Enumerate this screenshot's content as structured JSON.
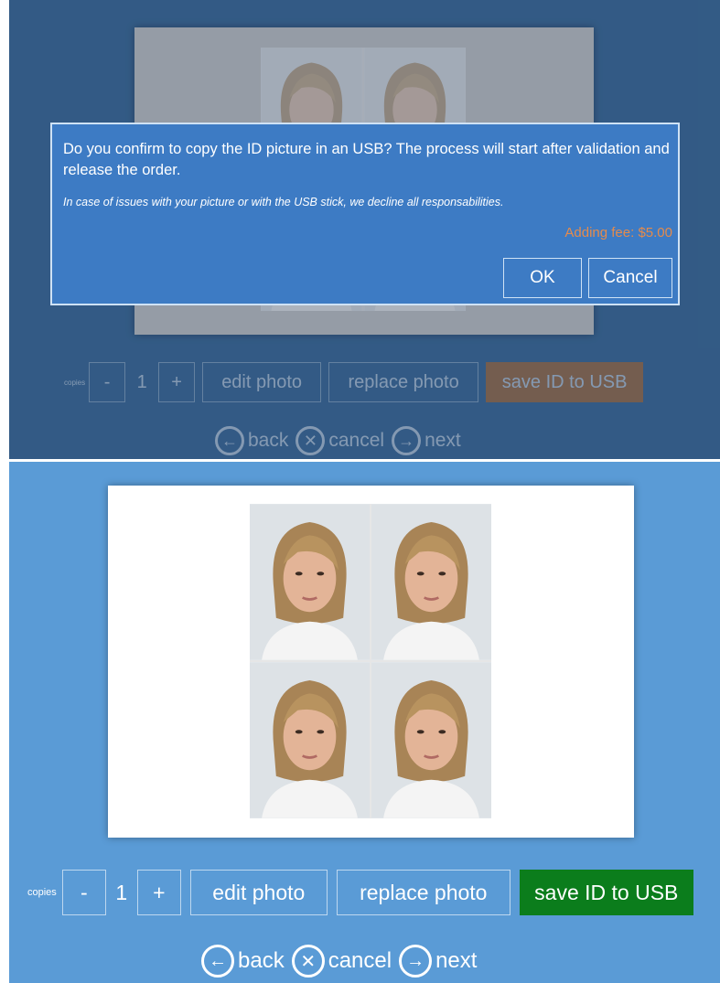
{
  "dialog": {
    "message": "Do you confirm to copy the ID picture in an USB? The process will start after validation and release the order.",
    "warning": "In case of issues with your picture or with the USB stick, we decline all responsabilities.",
    "fee": "Adding fee: $5.00",
    "ok_label": "OK",
    "cancel_label": "Cancel"
  },
  "toolbar": {
    "copies_label": "copies",
    "minus_label": "-",
    "quantity": "1",
    "plus_label": "+",
    "edit_label": "edit photo",
    "replace_label": "replace photo",
    "save_label": "save ID to USB"
  },
  "nav": {
    "back_label": "back",
    "cancel_label": "cancel",
    "next_label": "next",
    "back_icon": "arrow-left-circle-icon",
    "cancel_icon": "x-circle-icon",
    "next_icon": "arrow-right-circle-icon"
  },
  "colors": {
    "top_panel_bg": "#3a6590",
    "bottom_panel_bg": "#5a9bd6",
    "dialog_bg": "#3d7bc4",
    "fee_text": "#e58b4c",
    "save_orange": "#d96c0f",
    "save_green": "#0b7d1c"
  }
}
